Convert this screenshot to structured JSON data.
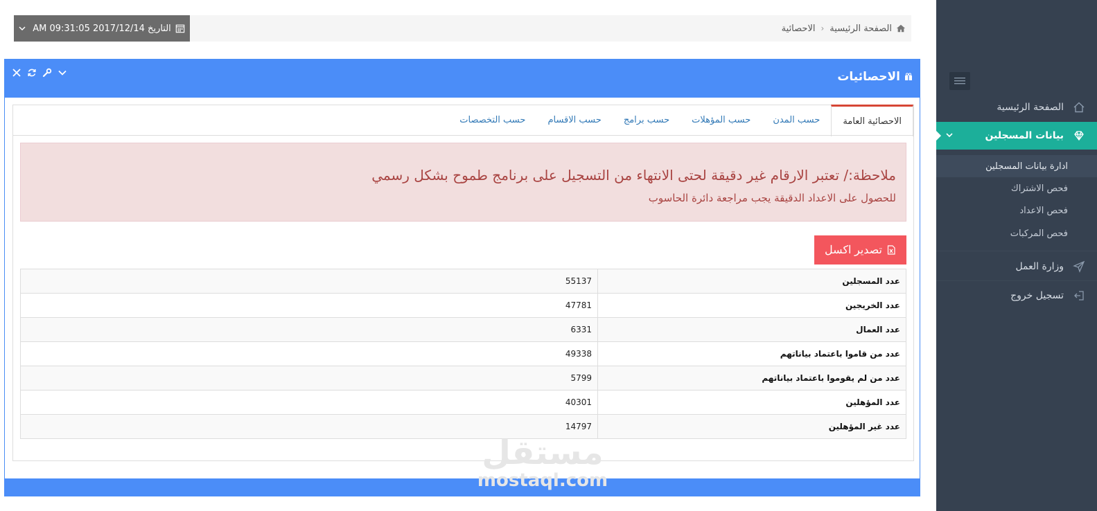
{
  "breadcrumb": {
    "home": "الصفحة الرئيسية",
    "current": "الاحصائية",
    "separator": "‹"
  },
  "date": {
    "label": "التاريخ 2017/12/14 09:31:05 AM"
  },
  "sidebar": {
    "home": "الصفحة الرئيسية",
    "registrants": "بيانات المسجلين",
    "sub_items": [
      "ادارة بيانات المسجلين",
      "فحص الاشتراك",
      "فحص الاعداد",
      "فحص المركبات"
    ],
    "labor": "وزارة العمل",
    "logout": "تسجيل خروج"
  },
  "portlet": {
    "title": "الاحصائيات"
  },
  "tabs": [
    "الاحصائية العامة",
    "حسب المدن",
    "حسب المؤهلات",
    "حسب برامج",
    "حسب الاقسام",
    "حسب التخصصات"
  ],
  "alert": {
    "line1": "ملاحظة:/ تعتبر الارقام غير دقيقة لحتى الانتهاء من التسجيل على برنامج طموح بشكل رسمي",
    "line2": "للحصول على الاعداد الدقيقة يجب مراجعة دائرة الحاسوب"
  },
  "export_button": "تصدير اكسل",
  "stats": [
    {
      "label": "عدد المسجلين",
      "value": "55137"
    },
    {
      "label": "عدد الخريجين",
      "value": "47781"
    },
    {
      "label": "عدد العمال",
      "value": "6331"
    },
    {
      "label": "عدد من قاموا باعتماد بياناتهم",
      "value": "49338"
    },
    {
      "label": "عدد من لم يقوموا باعتماد بياناتهم",
      "value": "5799"
    },
    {
      "label": "عدد المؤهلين",
      "value": "40301"
    },
    {
      "label": "عدد غير المؤهلين",
      "value": "14797"
    }
  ],
  "watermark": {
    "arabic": "مستقل",
    "latin": "mostaql.com"
  },
  "colors": {
    "sidebar_bg": "#364150",
    "sidebar_active": "#1caf9a",
    "portlet_blue": "#4b8df8",
    "alert_bg": "#f2dede",
    "alert_text": "#a94442",
    "export_btn": "#f3565d",
    "date_box": "#6b6b6b",
    "tab_active_border": "#d64635"
  }
}
